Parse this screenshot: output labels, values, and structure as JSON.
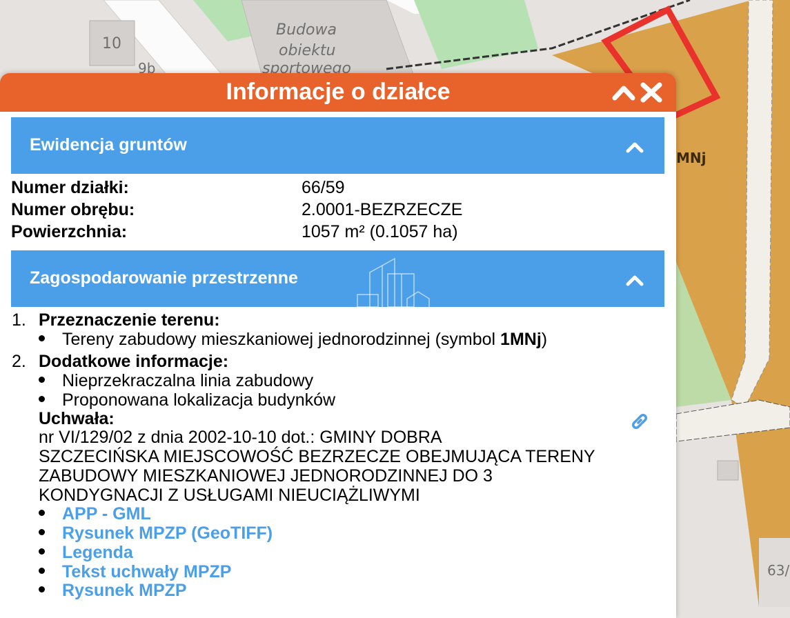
{
  "map": {
    "label_building": [
      "Budowa",
      "obiektu",
      "sportowego"
    ],
    "label_10": "10",
    "label_9b": "9b",
    "label_mnj": "MNj",
    "label_63": "63/",
    "highlight_color": "#e8322b",
    "zone_color": "#d9a14a"
  },
  "popup": {
    "title": "Informacje o działce",
    "header_color": "#e8622b",
    "section_color": "#4a9fe8"
  },
  "ewidencja": {
    "title": "Ewidencja gruntów",
    "rows": [
      {
        "label": "Numer działki:",
        "value": "66/59"
      },
      {
        "label": "Numer obrębu:",
        "value": "2.0001-BEZRZECZE"
      },
      {
        "label": "Powierzchnia:",
        "value": "1057 m² (0.1057 ha)"
      }
    ]
  },
  "zagospodarowanie": {
    "title": "Zagospodarowanie przestrzenne",
    "item1": {
      "num": "1.",
      "heading": "Przeznaczenie terenu:",
      "bullet_prefix": "Tereny zabudowy mieszkaniowej jednorodzinnej (symbol ",
      "bullet_symbol": "1MNj",
      "bullet_suffix": ")"
    },
    "item2": {
      "num": "2.",
      "heading": "Dodatkowe informacje:",
      "bullets": [
        "Nieprzekraczalna linia zabudowy",
        "Proponowana lokalizacja budynków"
      ],
      "uchwala_label": "Uchwała:",
      "uchwala_lines": [
        "nr VI/129/02 z dnia 2002-10-10 dot.: GMINY DOBRA",
        "SZCZECIŃSKA MIEJSCOWOŚĆ BEZRZECZE OBEJMUJĄCA TERENY",
        "ZABUDOWY MIESZKANIOWEJ JEDNORODZINNEJ DO 3",
        "KONDYGNACJI Z USŁUGAMI NIEUCIĄŻLIWYMI"
      ],
      "links": [
        "APP - GML",
        "Rysunek MPZP (GeoTIFF)",
        "Legenda",
        "Tekst uchwały MPZP",
        "Rysunek MPZP"
      ]
    }
  }
}
